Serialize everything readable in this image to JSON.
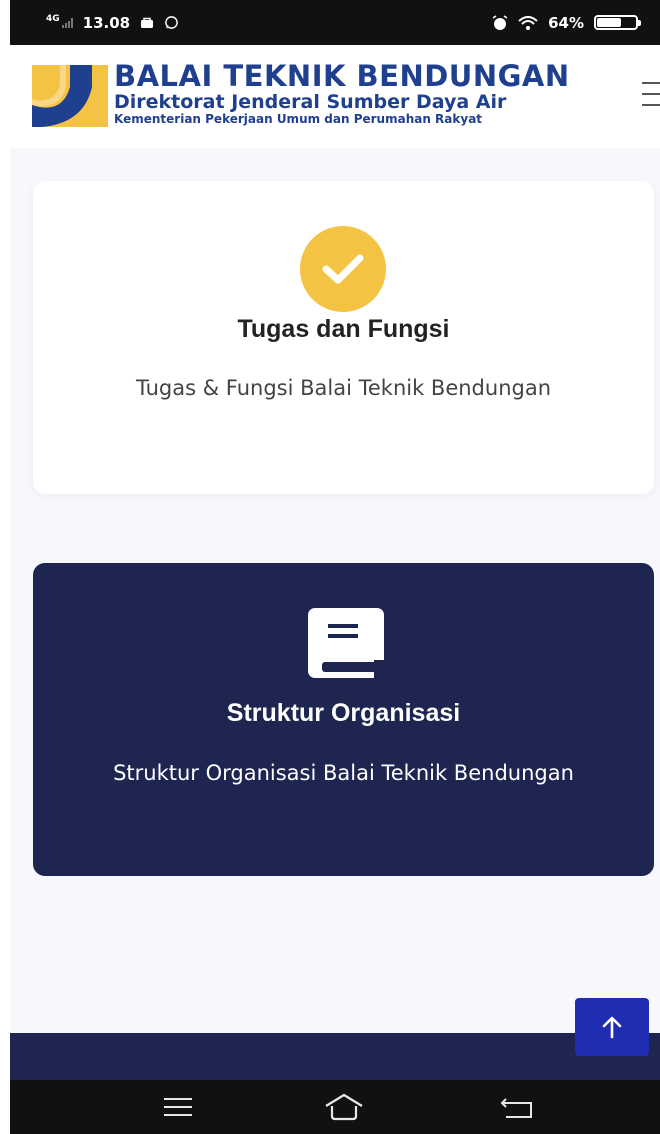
{
  "status_bar": {
    "network": "4G",
    "time": "13.08",
    "battery": "64%",
    "battery_level": 0.64
  },
  "header": {
    "title": "BALAI TEKNIK BENDUNGAN",
    "subtitle": "Direktorat Jenderal Sumber Daya Air",
    "ministry": "Kementerian Pekerjaan Umum dan Perumahan Rakyat"
  },
  "cards": [
    {
      "icon": "check-circle-icon",
      "title": "Tugas dan Fungsi",
      "description": "Tugas & Fungsi Balai Teknik Bendungan"
    },
    {
      "icon": "book-icon",
      "title": "Struktur Organisasi",
      "description": "Struktur Organisasi Balai Teknik Bendungan"
    }
  ],
  "colors": {
    "brand_blue": "#1f3f8f",
    "brand_yellow": "#f5c343",
    "navy": "#1e2551",
    "back_to_top": "#1e2db2"
  },
  "nav_icons": [
    "menu-icon",
    "home-icon",
    "back-icon"
  ]
}
